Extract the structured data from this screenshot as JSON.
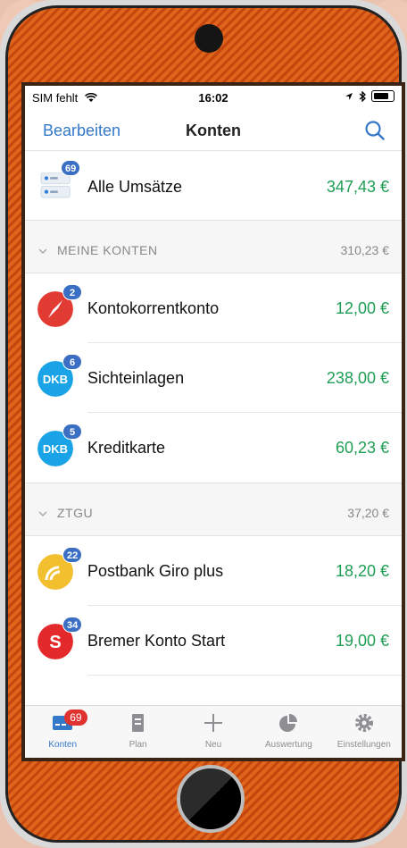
{
  "status_bar": {
    "carrier": "SIM fehlt",
    "time": "16:02"
  },
  "nav": {
    "edit_label": "Bearbeiten",
    "title": "Konten"
  },
  "all": {
    "label": "Alle Umsätze",
    "amount": "347,43 €",
    "badge": "69"
  },
  "sections": [
    {
      "title": "MEINE KONTEN",
      "total": "310,23 €",
      "accounts": [
        {
          "name": "Kontokorrentkonto",
          "amount": "12,00 €",
          "badge": "2",
          "icon": "compass-icon",
          "icon_color": "#e23b33"
        },
        {
          "name": "Sichteinlagen",
          "amount": "238,00 €",
          "badge": "6",
          "icon": "dkb-icon",
          "icon_text": "DKB",
          "icon_color": "#1aa3e6"
        },
        {
          "name": "Kreditkarte",
          "amount": "60,23 €",
          "badge": "5",
          "icon": "dkb-icon",
          "icon_text": "DKB",
          "icon_color": "#1aa3e6"
        }
      ]
    },
    {
      "title": "ZTGU",
      "total": "37,20 €",
      "accounts": [
        {
          "name": "Postbank Giro plus",
          "amount": "18,20 €",
          "badge": "22",
          "icon": "postbank-icon",
          "icon_color": "#f2c02e"
        },
        {
          "name": "Bremer Konto Start",
          "amount": "19,00 €",
          "badge": "34",
          "icon": "sparkasse-icon",
          "icon_text": "S",
          "icon_color": "#e3292b"
        }
      ]
    }
  ],
  "tabs": [
    {
      "label": "Konten",
      "icon": "accounts-icon",
      "badge": "69",
      "active": true
    },
    {
      "label": "Plan",
      "icon": "plan-icon"
    },
    {
      "label": "Neu",
      "icon": "plus-icon"
    },
    {
      "label": "Auswertung",
      "icon": "pie-chart-icon"
    },
    {
      "label": "Einstellungen",
      "icon": "gear-icon"
    }
  ],
  "colors": {
    "accent": "#3478c8",
    "positive": "#1e9e55",
    "badge": "#3a6fc4",
    "tab_badge": "#e0322e"
  }
}
